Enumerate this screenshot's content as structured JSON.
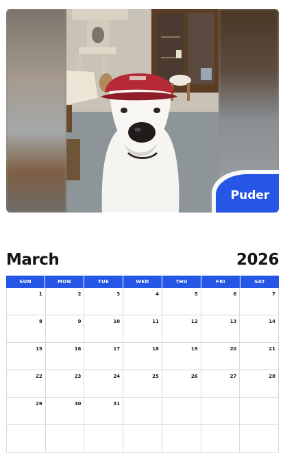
{
  "photo": {
    "pet_name": "Puder",
    "badge_color": "#2656e6"
  },
  "header": {
    "month": "March",
    "year": "2026"
  },
  "calendar": {
    "accent_color": "#2656e6",
    "weekdays": [
      "SUN",
      "MON",
      "TUE",
      "WED",
      "THU",
      "FRI",
      "SAT"
    ],
    "weeks": [
      [
        "1",
        "2",
        "3",
        "4",
        "5",
        "6",
        "7"
      ],
      [
        "8",
        "9",
        "10",
        "11",
        "12",
        "13",
        "14"
      ],
      [
        "15",
        "16",
        "17",
        "18",
        "19",
        "20",
        "21"
      ],
      [
        "22",
        "23",
        "24",
        "25",
        "26",
        "27",
        "28"
      ],
      [
        "29",
        "30",
        "31",
        "",
        "",
        "",
        ""
      ],
      [
        "",
        "",
        "",
        "",
        "",
        "",
        ""
      ]
    ]
  }
}
